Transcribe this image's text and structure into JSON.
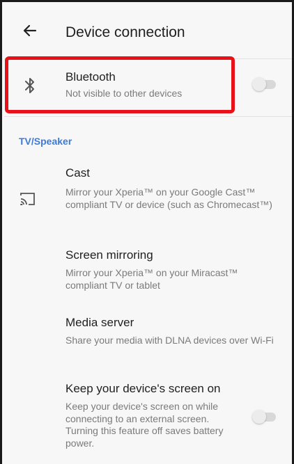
{
  "header": {
    "title": "Device connection",
    "back_icon": "arrow-back-icon"
  },
  "bluetooth": {
    "title": "Bluetooth",
    "summary": "Not visible to other devices",
    "icon": "bluetooth-icon",
    "enabled": false
  },
  "section": {
    "label": "TV/Speaker",
    "color": "#3d7bd9"
  },
  "items": [
    {
      "title": "Cast",
      "summary": "Mirror your Xperia™ on your Google Cast™ compliant TV or device (such as Chromecast™)",
      "icon": "cast-icon"
    },
    {
      "title": "Screen mirroring",
      "summary": "Mirror your Xperia™ on your Miracast™ compliant TV or tablet"
    },
    {
      "title": "Media server",
      "summary": "Share your media with DLNA devices over Wi-Fi"
    },
    {
      "title": "Keep your device's screen on",
      "summary": "Keep your device's screen on while connecting to an external screen. Turning this feature off saves battery power.",
      "enabled": false
    }
  ],
  "annotation": {
    "highlight_color": "#e8111a"
  }
}
